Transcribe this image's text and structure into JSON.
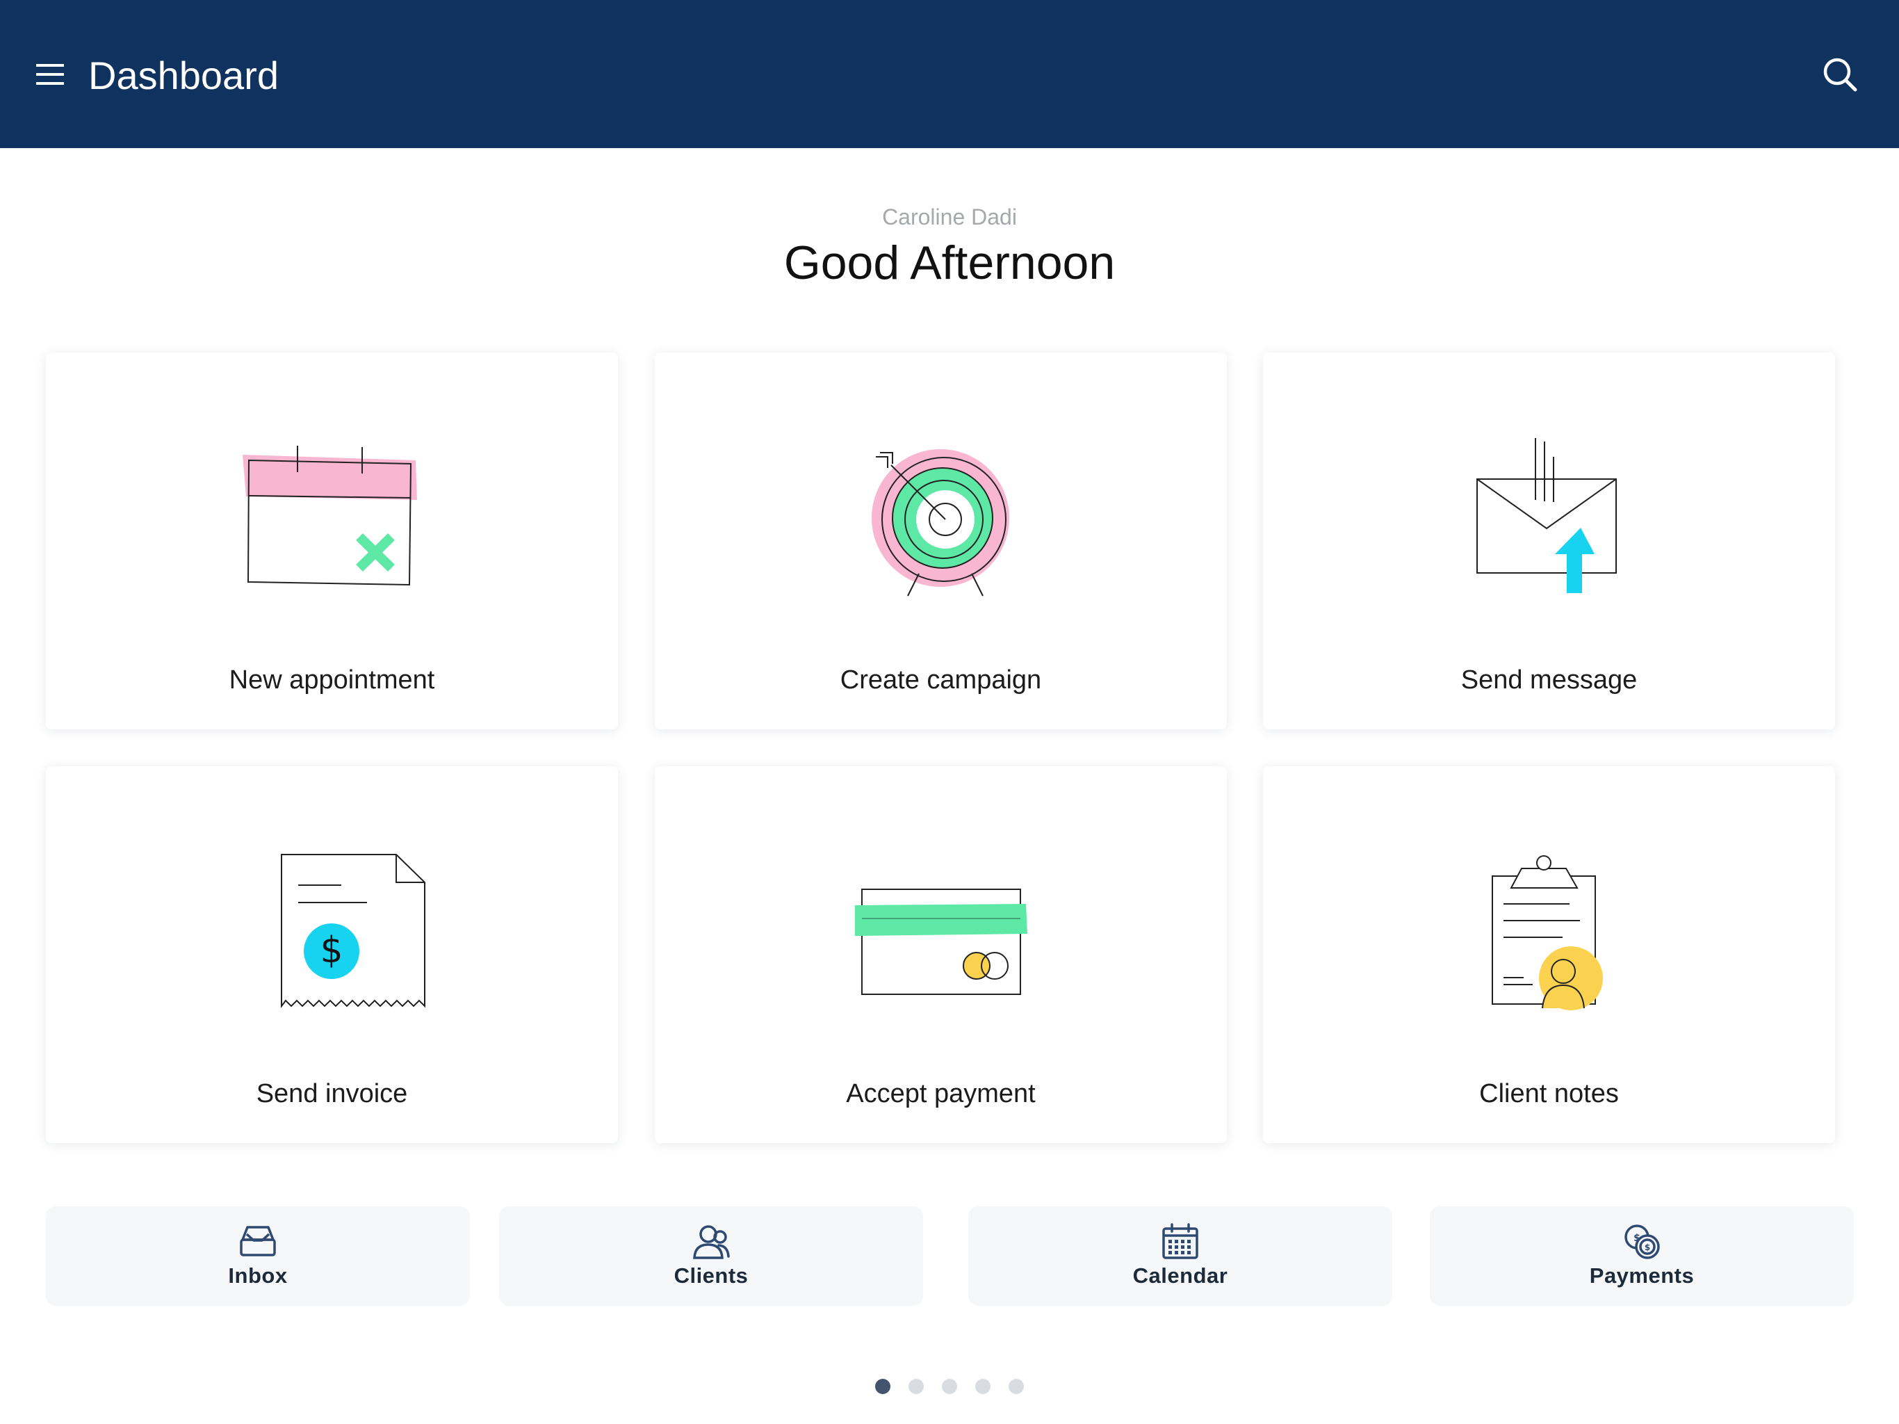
{
  "header": {
    "title": "Dashboard",
    "menu_icon": "hamburger-menu-icon",
    "search_icon": "search-icon"
  },
  "greeting": {
    "user_name": "Caroline Dadi",
    "message": "Good Afternoon"
  },
  "actions": [
    {
      "label": "New appointment",
      "icon": "calendar-cancel-illustration"
    },
    {
      "label": "Create campaign",
      "icon": "target-illustration"
    },
    {
      "label": "Send message",
      "icon": "envelope-send-illustration"
    },
    {
      "label": "Send invoice",
      "icon": "invoice-dollar-illustration"
    },
    {
      "label": "Accept payment",
      "icon": "credit-card-illustration"
    },
    {
      "label": "Client notes",
      "icon": "clipboard-client-illustration"
    }
  ],
  "quick_links": [
    {
      "label": "Inbox",
      "icon": "inbox-icon"
    },
    {
      "label": "Clients",
      "icon": "clients-icon"
    },
    {
      "label": "Calendar",
      "icon": "calendar-icon"
    },
    {
      "label": "Payments",
      "icon": "payments-icon"
    }
  ],
  "pagination": {
    "total_pages": 5,
    "current_page": 1
  },
  "colors": {
    "header_bg": "#0f325f",
    "pink": "#f8b6d0",
    "green": "#5ee8a6",
    "cyan": "#17d3f0",
    "yellow": "#fbd250"
  }
}
